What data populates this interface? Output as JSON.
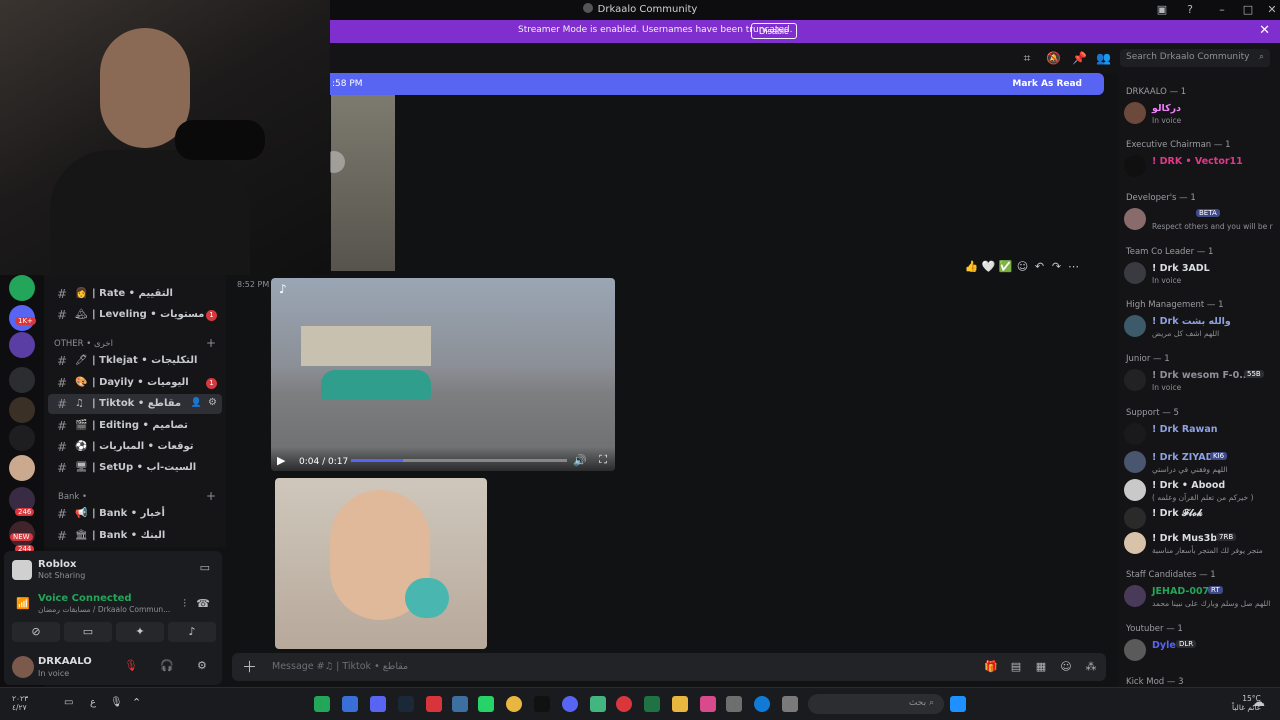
{
  "window": {
    "title": "Drkaalo Community"
  },
  "banner": {
    "message": "Streamer Mode is enabled. Usernames have been truncated.",
    "disable_label": "Disable"
  },
  "header": {
    "search_placeholder": "Search Drkaalo Community"
  },
  "new_messages": {
    "time": ":58 PM",
    "mark_read": "Mark As Read"
  },
  "message": {
    "time": "8:52 PM"
  },
  "video": {
    "time_display": "0:04 / 0:17",
    "progress": 0.24
  },
  "composer": {
    "placeholder": "Message #♫ | Tiktok • مقاطع"
  },
  "channels": {
    "items": [
      {
        "emoji": "👩",
        "label": "| Rate • التقييم",
        "count": ""
      },
      {
        "emoji": "🏔",
        "label": "| Leveling • مستويات",
        "count": "1"
      },
      {
        "emoji": "🖊",
        "label": "| Tklejat • التكليجات",
        "count": ""
      },
      {
        "emoji": "🎨",
        "label": "| Dayily • اليوميات",
        "count": "1"
      },
      {
        "emoji": "♫",
        "label": "| Tiktok • مقاطع",
        "count": ""
      },
      {
        "emoji": "🎬",
        "label": "| Editing • تصاميم",
        "count": ""
      },
      {
        "emoji": "⚽",
        "label": "| توقعات • المباريات",
        "count": ""
      },
      {
        "emoji": "🖥",
        "label": "| SetUp • السيت-اب",
        "count": ""
      },
      {
        "emoji": "📢",
        "label": "| Bank • أخبار",
        "count": ""
      },
      {
        "emoji": "🏛",
        "label": "| Bank • البنك",
        "count": ""
      }
    ],
    "categories": {
      "other": "OTHER • اخرى",
      "bank": "Bank •"
    }
  },
  "guild_badges": {
    "b1": "1K+",
    "b2": "246",
    "b3": "NEW",
    "b4": "244"
  },
  "panel": {
    "game": "Roblox",
    "game_status": "Not Sharing",
    "voice": "Voice Connected",
    "voice_channel": "مسابقات رمضان / Drkaalo Commun...",
    "username": "DRKAALO",
    "user_status": "In voice"
  },
  "members": {
    "roles": [
      "DRKAALO — 1",
      "Executive Chairman — 1",
      "Developer's — 1",
      "Team Co Leader — 1",
      "High Management — 1",
      "Junior — 1",
      "Support — 5",
      "Staff Candidates — 1",
      "Youtuber — 1",
      "Kick Mod — 3"
    ],
    "list": [
      {
        "name": "دركالو",
        "sub": "In voice",
        "color": "#f47fff",
        "badge": ""
      },
      {
        "name": "! DRK • Vector11",
        "sub": "",
        "color": "#e0388a",
        "badge": ""
      },
      {
        "name": "",
        "sub": "Respect others and you will be r",
        "color": "#e03840",
        "badge": "BETA"
      },
      {
        "name": "! Drk 3ADL",
        "sub": "In voice",
        "color": "#dbdee1",
        "badge": ""
      },
      {
        "name": "! Drk والله بشت",
        "sub": "اللهم اشف كل مريض",
        "color": "#8ea1e1",
        "badge": ""
      },
      {
        "name": "! Drk wesom F-0..",
        "sub": "In voice",
        "color": "#8d9096",
        "badge": "55B"
      },
      {
        "name": "! Drk Rawan",
        "sub": "",
        "color": "#8ea1e1",
        "badge": ""
      },
      {
        "name": "! Drk ZIYAD",
        "sub": "اللهم وفقني في دراستي",
        "color": "#8ea1e1",
        "badge": "KI6"
      },
      {
        "name": "! Drk • Abood",
        "sub": "( خيركم من تعلم القرآن وعلمه )",
        "color": "#dbdee1",
        "badge": ""
      },
      {
        "name": "! Drk 𝓕𝓵𝓸𝓴",
        "sub": "",
        "color": "#dbdee1",
        "badge": ""
      },
      {
        "name": "! Drk Mus3b",
        "sub": "متجر يوفر لك المتجر بأسعار مناسبة",
        "color": "#dbdee1",
        "badge": "7RB"
      },
      {
        "name": "JEHAD-007-",
        "sub": "اللهم صل وسلم وبارك على نبينا محمد",
        "color": "#23a55a",
        "badge": "RT"
      },
      {
        "name": "Dyle",
        "sub": "",
        "color": "#5865f2",
        "badge": "DLR"
      }
    ]
  },
  "taskbar": {
    "lang_line1": "٢٠٢٣",
    "lang_line2": "٤/٢٧",
    "lang": "ع",
    "search": "بحث",
    "temp": "15°C",
    "weather_text": "غائم غالباً"
  }
}
